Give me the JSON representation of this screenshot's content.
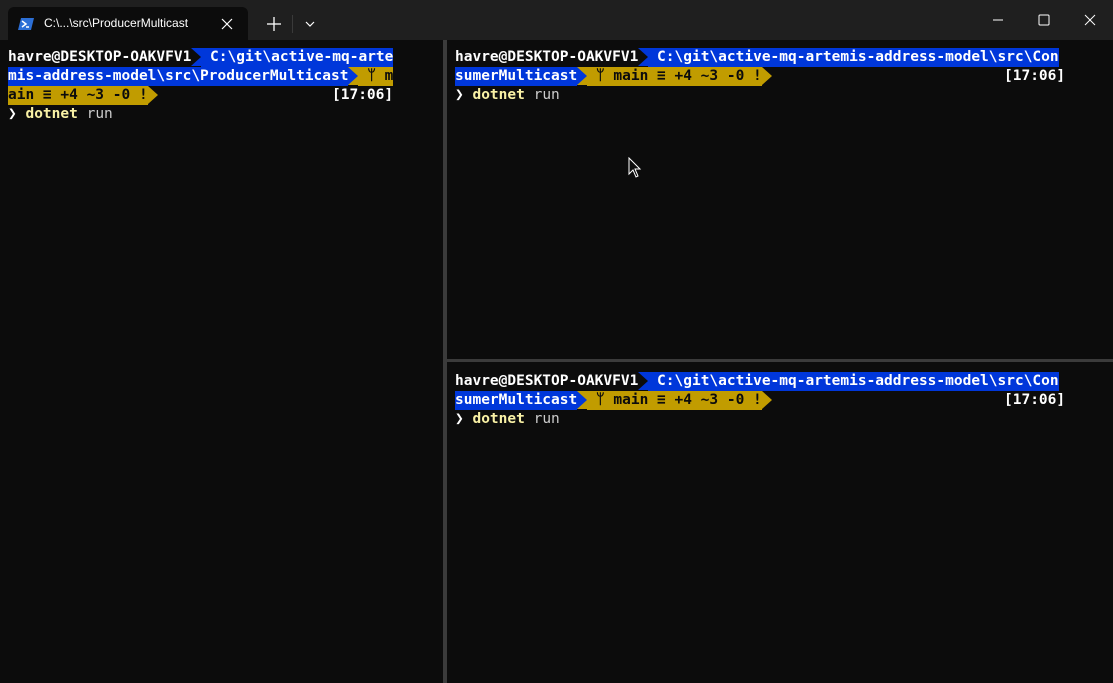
{
  "titlebar": {
    "tab_title": "C:\\...\\src\\ProducerMulticast",
    "icons": {
      "tab": "powershell-icon",
      "close_tab": "close-icon",
      "new_tab": "plus-icon",
      "dropdown": "chevron-down-icon",
      "minimize": "minimize-icon",
      "maximize": "maximize-icon",
      "close": "close-icon"
    }
  },
  "colors": {
    "background": "#0c0c0c",
    "path_segment": "#0037da",
    "git_segment": "#c19c00",
    "command_name": "#f9f1a5"
  },
  "panes": {
    "left": {
      "user": "havre@DESKTOP-OAKVFV1",
      "path_line1": " C:\\git\\active-mq-arte",
      "path_line2": "mis-address-model\\src\\ProducerMulticast",
      "git_line2": " ᛘ m",
      "git_line3": "ain ≡ +4 ~3 -0 !",
      "time": "[17:06]",
      "prompt": "❯",
      "command": "dotnet",
      "argument": "run"
    },
    "top_right": {
      "user": "havre@DESKTOP-OAKVFV1",
      "path_line1": " C:\\git\\active-mq-artemis-address-model\\src\\Con",
      "path_line2": "sumerMulticast",
      "git_line2": " ᛘ main ≡ +4 ~3 -0 !",
      "time": "[17:06]",
      "prompt": "❯",
      "command": "dotnet",
      "argument": "run"
    },
    "bottom_right": {
      "user": "havre@DESKTOP-OAKVFV1",
      "path_line1": " C:\\git\\active-mq-artemis-address-model\\src\\Con",
      "path_line2": "sumerMulticast",
      "git_line2": " ᛘ main ≡ +4 ~3 -0 !",
      "time": "[17:06]",
      "prompt": "❯",
      "command": "dotnet",
      "argument": "run"
    }
  }
}
